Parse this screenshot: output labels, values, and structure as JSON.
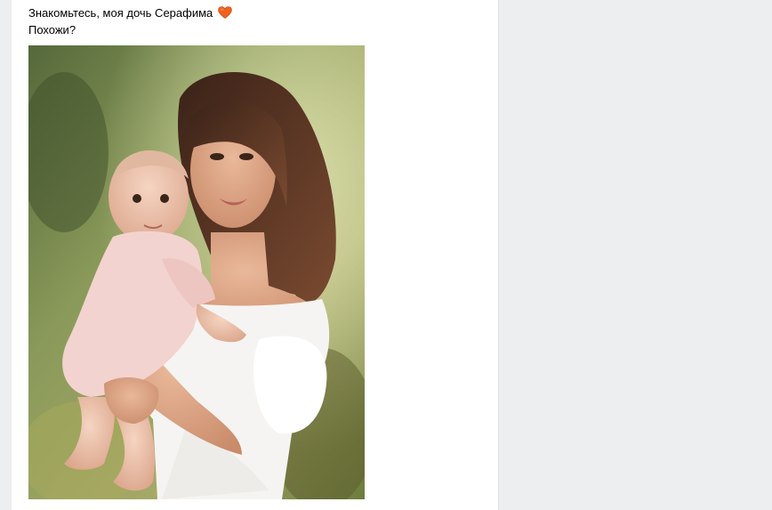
{
  "post": {
    "text_line_1": "Знакомьтесь, моя дочь Серафима",
    "text_line_2": "Похожи?",
    "emoji": "heart-icon"
  },
  "colors": {
    "page_background": "#edeef0",
    "card_background": "#ffffff",
    "text": "#000000",
    "heart": "#f0601e"
  }
}
